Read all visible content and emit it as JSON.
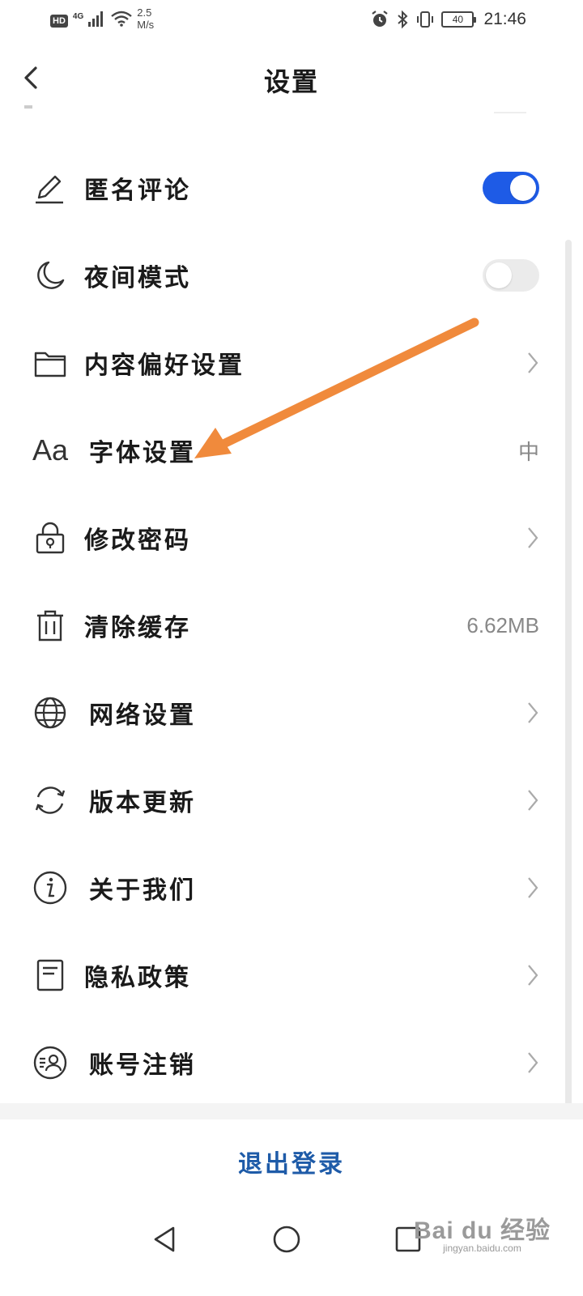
{
  "status_bar": {
    "hd": "HD",
    "network": "4G",
    "speed_value": "2.5",
    "speed_unit": "M/s",
    "battery": "40",
    "time": "21:46"
  },
  "header": {
    "title": "设置"
  },
  "settings": [
    {
      "label": "匿名评论",
      "icon": "pencil-icon",
      "control": "toggle",
      "state": "on"
    },
    {
      "label": "夜间模式",
      "icon": "moon-icon",
      "control": "toggle",
      "state": "off"
    },
    {
      "label": "内容偏好设置",
      "icon": "folder-icon",
      "control": "chevron"
    },
    {
      "label": "字体设置",
      "icon": "font-aa-icon",
      "control": "value",
      "value": "中"
    },
    {
      "label": "修改密码",
      "icon": "lock-icon",
      "control": "chevron"
    },
    {
      "label": "清除缓存",
      "icon": "trash-icon",
      "control": "value",
      "value": "6.62MB"
    },
    {
      "label": "网络设置",
      "icon": "globe-icon",
      "control": "chevron"
    },
    {
      "label": "版本更新",
      "icon": "refresh-icon",
      "control": "chevron"
    },
    {
      "label": "关于我们",
      "icon": "info-icon",
      "control": "chevron"
    },
    {
      "label": "隐私政策",
      "icon": "document-icon",
      "control": "chevron"
    },
    {
      "label": "账号注销",
      "icon": "account-icon",
      "control": "chevron"
    }
  ],
  "font_icon_text": "Aa",
  "logout_label": "退出登录",
  "watermark": {
    "main": "Bai du 经验",
    "sub": "jingyan.baidu.com"
  },
  "colors": {
    "accent_blue": "#1e5be6",
    "logout_blue": "#1e5ba8",
    "annotation_orange": "#f08a3c"
  }
}
